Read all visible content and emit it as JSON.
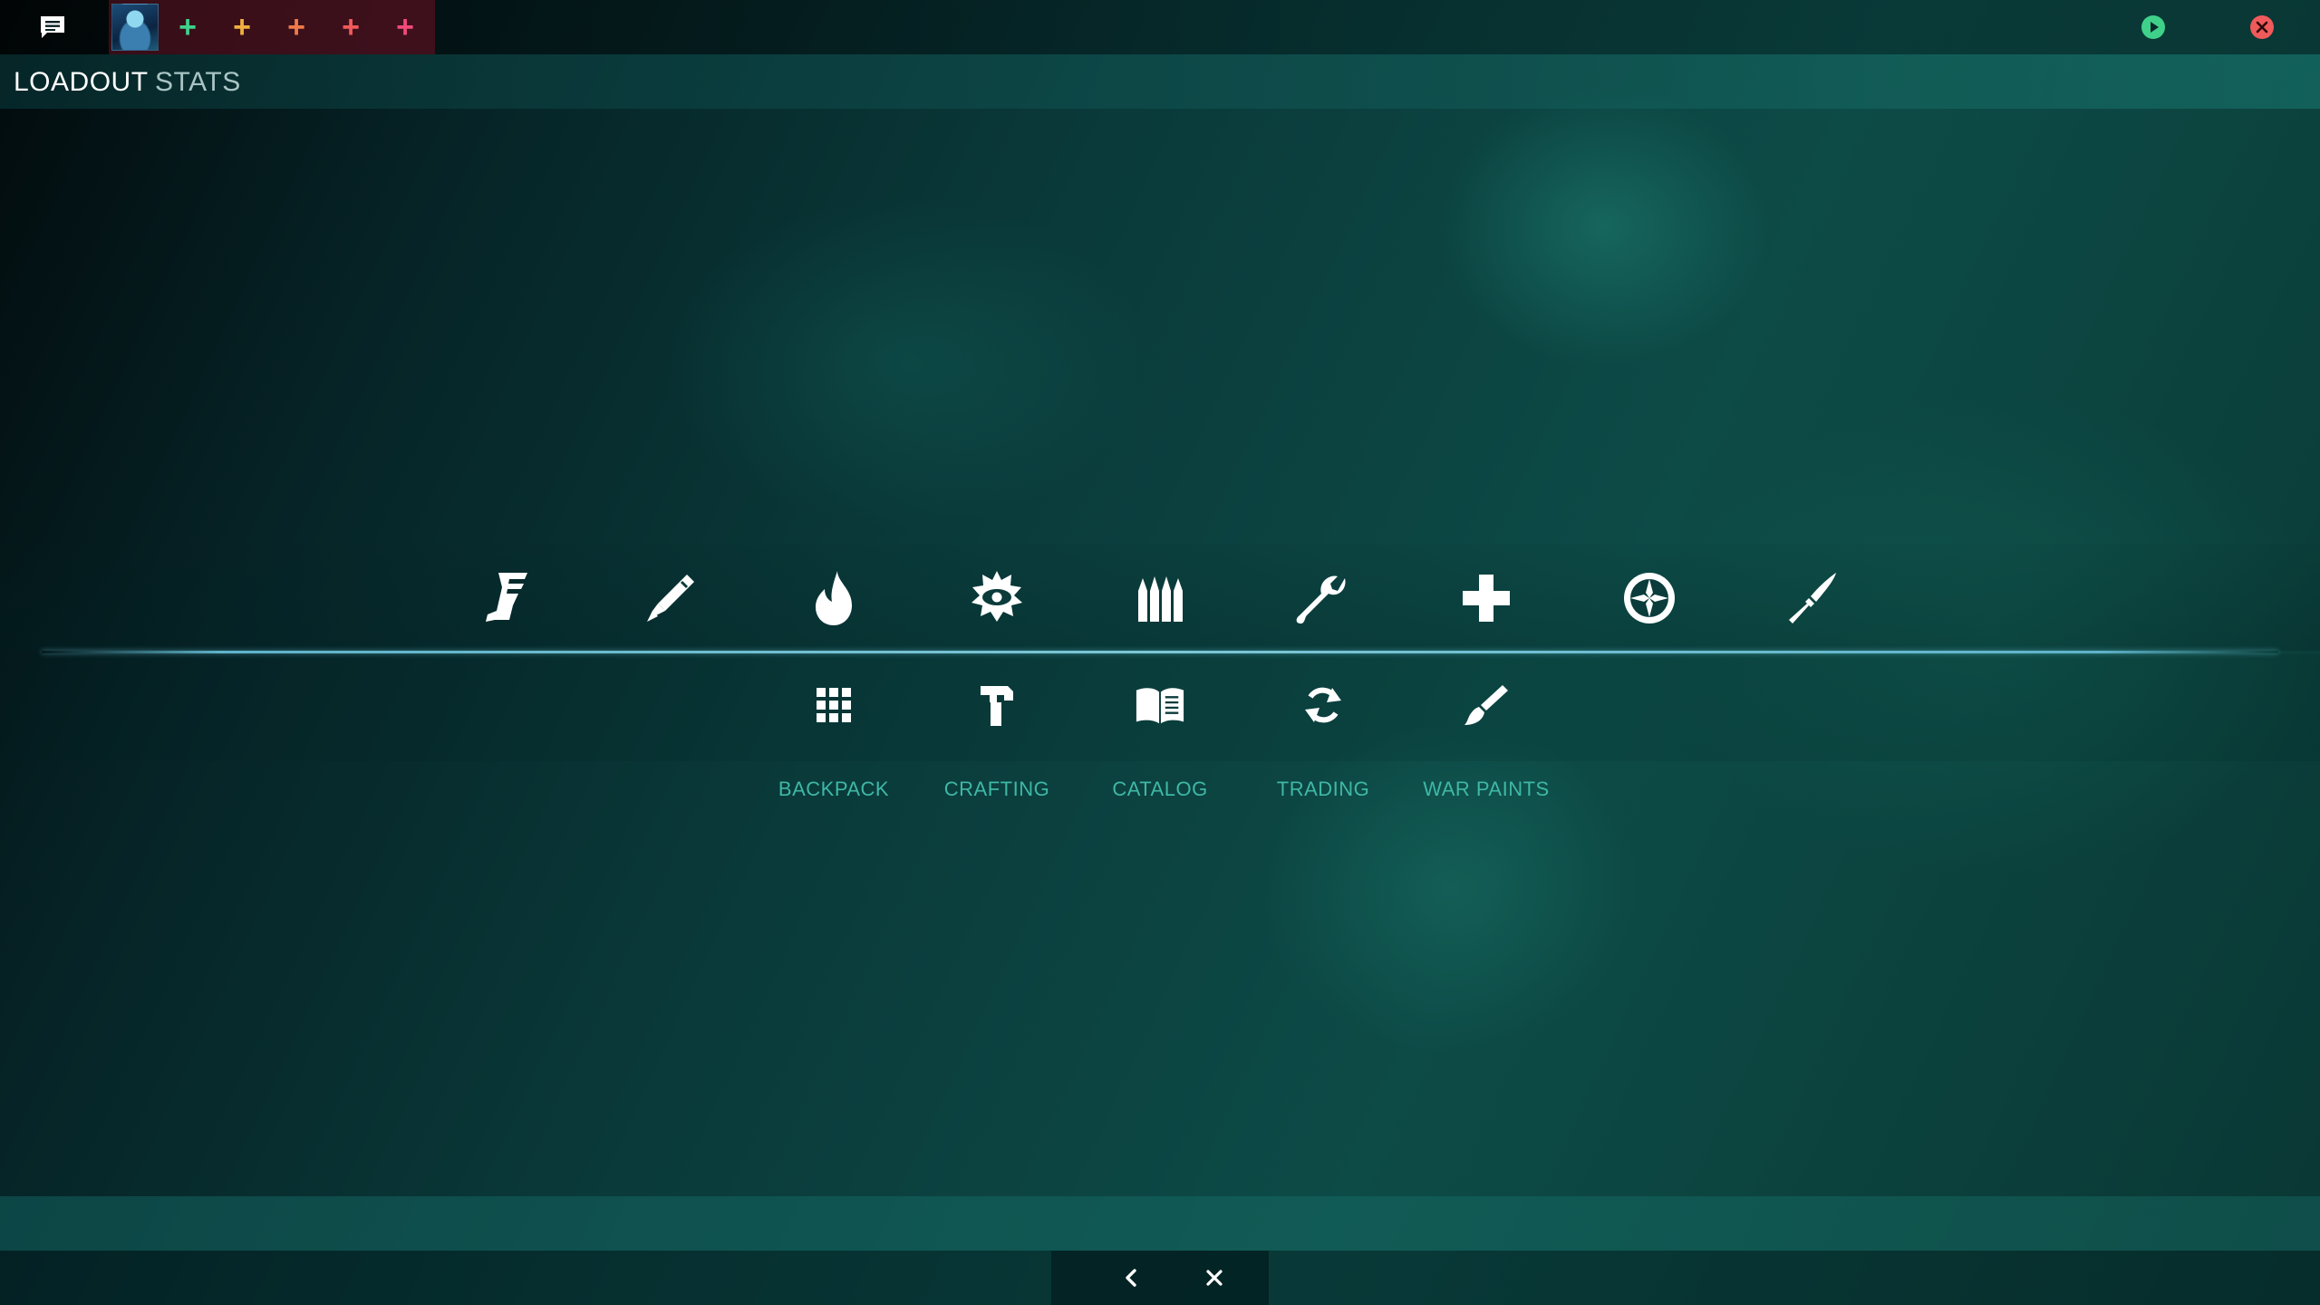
{
  "topbar": {
    "chat_icon": "chat-bubble-icon",
    "party_slots": [
      {
        "symbol": "+",
        "color": "#3fd18a"
      },
      {
        "symbol": "+",
        "color": "#f0b040"
      },
      {
        "symbol": "+",
        "color": "#f07a4a"
      },
      {
        "symbol": "+",
        "color": "#f05a5a"
      },
      {
        "symbol": "+",
        "color": "#f04a7a"
      }
    ],
    "play_icon": "play-circle-icon",
    "play_color": "#3fd18a",
    "close_icon": "close-circle-icon",
    "close_color": "#f05a5a"
  },
  "title": {
    "loadout_label": "LOADOUT",
    "stats_label": "STATS"
  },
  "classes": [
    {
      "name": "scout",
      "icon": "winged-boot-icon"
    },
    {
      "name": "soldier",
      "icon": "rocket-icon"
    },
    {
      "name": "pyro",
      "icon": "flame-icon"
    },
    {
      "name": "demoman",
      "icon": "eye-burst-icon"
    },
    {
      "name": "heavy",
      "icon": "bullets-icon"
    },
    {
      "name": "engineer",
      "icon": "wrench-icon"
    },
    {
      "name": "medic",
      "icon": "medical-cross-icon"
    },
    {
      "name": "sniper",
      "icon": "crosshair-icon"
    },
    {
      "name": "spy",
      "icon": "knife-icon"
    }
  ],
  "menu": {
    "backpack": {
      "label": "BACKPACK",
      "icon": "grid-icon"
    },
    "crafting": {
      "label": "CRAFTING",
      "icon": "hammer-icon"
    },
    "catalog": {
      "label": "CATALOG",
      "icon": "open-book-icon"
    },
    "trading": {
      "label": "TRADING",
      "icon": "refresh-icon"
    },
    "war_paints": {
      "label": "WAR PAINTS",
      "icon": "paintbrush-icon"
    }
  },
  "accent": {
    "label_color": "#3fb8a6",
    "divider_color": "#7cc6d6"
  },
  "bottom_nav": {
    "back_icon": "chevron-left-icon",
    "close_icon": "close-icon"
  }
}
